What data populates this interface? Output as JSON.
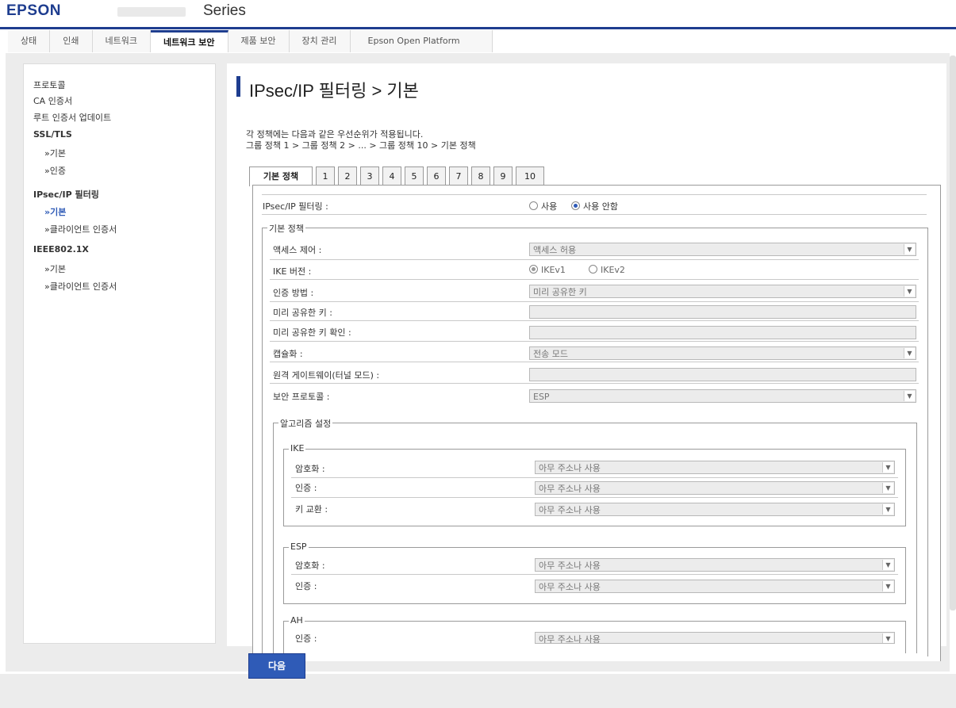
{
  "header": {
    "brand": "EPSON",
    "series": "Series"
  },
  "tabs": [
    "상태",
    "인쇄",
    "네트워크",
    "네트워크 보안",
    "제품 보안",
    "장치 관리",
    "Epson Open Platform"
  ],
  "sidebar": {
    "items": [
      "프로토콜",
      "CA 인증서",
      "루트 인증서 업데이트",
      "SSL/TLS",
      "»기본",
      "»인증",
      "IPsec/IP 필터링",
      "»기본",
      "»클라이언트 인증서",
      "IEEE802.1X",
      "»기본",
      "»클라이언트 인증서"
    ]
  },
  "main": {
    "title": "IPsec/IP 필터링 > 기본",
    "desc_line1": "각 정책에는 다음과 같은 우선순위가 적용됩니다.",
    "desc_line2": "그룹 정책 1 > 그룹 정책 2 > ... > 그룹 정책 10 > 기본 정책",
    "policy_tabs": [
      "기본 정책",
      "1",
      "2",
      "3",
      "4",
      "5",
      "6",
      "7",
      "8",
      "9",
      "10"
    ],
    "filtering": {
      "label": "IPsec/IP 필터링 :",
      "opt_on": "사용",
      "opt_off": "사용 안함"
    },
    "basic_policy_legend": "기본 정책",
    "access_control": {
      "label": "액세스 제어 :",
      "value": "액세스 허용"
    },
    "ike_version": {
      "label": "IKE 버전 :",
      "opt1": "IKEv1",
      "opt2": "IKEv2"
    },
    "auth_method": {
      "label": "인증 방법 :",
      "value": "미리 공유한 키"
    },
    "psk": {
      "label": "미리 공유한 키 :"
    },
    "psk_confirm": {
      "label": "미리 공유한 키 확인 :"
    },
    "encapsulation": {
      "label": "캡슐화 :",
      "value": "전송 모드"
    },
    "remote_gateway": {
      "label": "원격 게이트웨이(터널 모드) :"
    },
    "security_protocol": {
      "label": "보안 프로토콜 :",
      "value": "ESP"
    },
    "algo_legend": "알고리즘 설정",
    "ike": {
      "legend": "IKE",
      "encryption": {
        "label": "암호화 :",
        "value": "아무 주소나 사용"
      },
      "auth": {
        "label": "인증 :",
        "value": "아무 주소나 사용"
      },
      "key_exchange": {
        "label": "키 교환 :",
        "value": "아무 주소나 사용"
      }
    },
    "esp": {
      "legend": "ESP",
      "encryption": {
        "label": "암호화 :",
        "value": "아무 주소나 사용"
      },
      "auth": {
        "label": "인증 :",
        "value": "아무 주소나 사용"
      }
    },
    "ah": {
      "legend": "AH",
      "auth": {
        "label": "인증 :",
        "value": "아무 주소나 사용"
      }
    },
    "next_button": "다음"
  },
  "colors": {
    "brand": "#1e3d8f",
    "accent": "#2f5bb7"
  }
}
